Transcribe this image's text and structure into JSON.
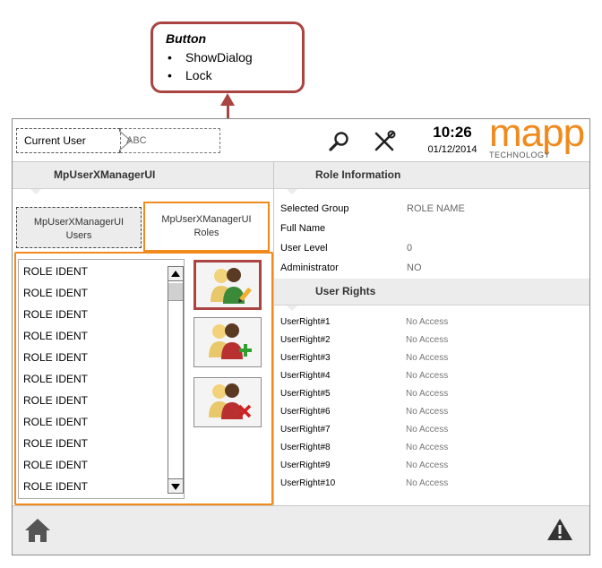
{
  "callout": {
    "title": "Button",
    "items": [
      "ShowDialog",
      "Lock"
    ]
  },
  "header": {
    "user_label": "Current User",
    "user_value": "ABC",
    "time": "10:26",
    "date": "01/12/2014",
    "logo_main": "mapp",
    "logo_sub": "TECHNOLOGY",
    "icons": [
      "search-icon",
      "wrench-icon"
    ]
  },
  "left": {
    "title": "MpUserXManagerUI",
    "tab_users": [
      "MpUserXManagerUI",
      "Users"
    ],
    "tab_roles": [
      "MpUserXManagerUI",
      "Roles"
    ],
    "roles": [
      "ROLE IDENT",
      "ROLE IDENT",
      "ROLE IDENT",
      "ROLE IDENT",
      "ROLE IDENT",
      "ROLE IDENT",
      "ROLE IDENT",
      "ROLE IDENT",
      "ROLE IDENT",
      "ROLE IDENT",
      "ROLE IDENT"
    ],
    "buttons": [
      "edit-role-icon",
      "add-role-icon",
      "delete-role-icon"
    ]
  },
  "role_info": {
    "title": "Role Information",
    "rows": [
      {
        "label": "Selected Group",
        "value": "ROLE NAME"
      },
      {
        "label": "Full Name",
        "value": ""
      },
      {
        "label": "User Level",
        "value": "0"
      },
      {
        "label": "Administrator",
        "value": "NO"
      }
    ]
  },
  "user_rights": {
    "title": "User Rights",
    "rows": [
      {
        "label": "UserRight#1",
        "value": "No Access"
      },
      {
        "label": "UserRight#2",
        "value": "No Access"
      },
      {
        "label": "UserRight#3",
        "value": "No Access"
      },
      {
        "label": "UserRight#4",
        "value": "No Access"
      },
      {
        "label": "UserRight#5",
        "value": "No Access"
      },
      {
        "label": "UserRight#6",
        "value": "No Access"
      },
      {
        "label": "UserRight#7",
        "value": "No Access"
      },
      {
        "label": "UserRight#8",
        "value": "No Access"
      },
      {
        "label": "UserRight#9",
        "value": "No Access"
      },
      {
        "label": "UserRight#10",
        "value": "No Access"
      }
    ]
  },
  "footer": {
    "icons": [
      "home-icon",
      "warning-icon"
    ]
  },
  "colors": {
    "accent_orange": "#f08a1c",
    "callout_red": "#a94442",
    "panel_gray": "#ececec"
  }
}
